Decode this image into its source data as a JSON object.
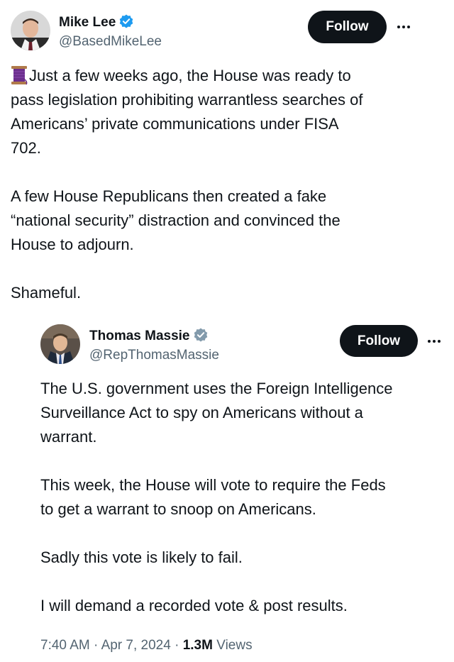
{
  "main_tweet": {
    "author_name": "Mike Lee",
    "author_handle": "@BasedMikeLee",
    "follow_label": "Follow",
    "more_icon": "more-horizontal-icon",
    "text_line_1": "Just a few weeks ago, the House was ready to",
    "text_line_2": "pass legislation prohibiting warrantless searches of",
    "text_line_3": "Americans’ private communications under FISA",
    "text_line_4": "702.",
    "paragraph_2_line_1": "A few House Republicans then created a fake",
    "paragraph_2_line_2": "“national security” distraction and convinced the",
    "paragraph_2_line_3": "House to adjourn.",
    "paragraph_3": "Shameful.",
    "emoji_icon": "spool-of-thread-icon"
  },
  "quoted_tweet": {
    "author_name": "Thomas Massie",
    "author_handle": "@RepThomasMassie",
    "follow_label": "Follow",
    "p1_line_1": "The U.S. government uses the Foreign Intelligence",
    "p1_line_2": "Surveillance Act to spy on Americans without a",
    "p1_line_3": "warrant.",
    "p2_line_1": "This week, the House will vote to require the Feds",
    "p2_line_2": "to get a warrant to snoop on Americans.",
    "p3": "Sadly this vote is likely to fail.",
    "p4": "I will demand a recorded vote & post results.",
    "time": "7:40 AM",
    "date": "Apr 7, 2024",
    "views_count": "1.3M",
    "views_label": "Views",
    "separator": "·"
  },
  "colors": {
    "text": "#0f1419",
    "secondary": "#536471",
    "verified_blue": "#1d9bf0",
    "verified_gray": "#829aab",
    "button_bg": "#0f1419"
  }
}
